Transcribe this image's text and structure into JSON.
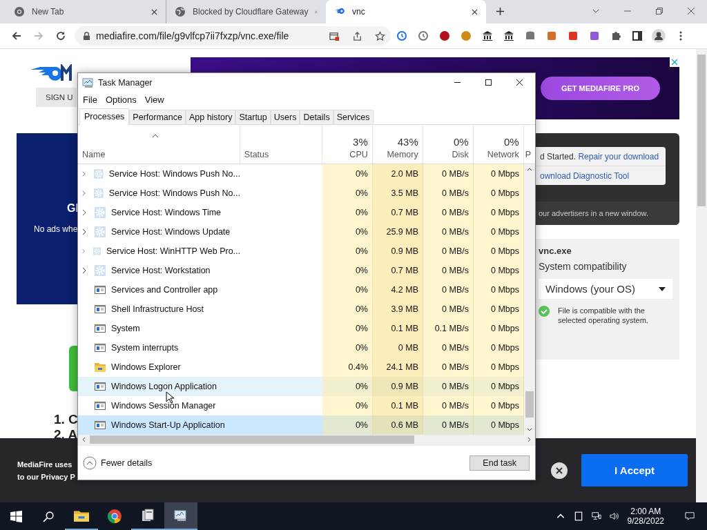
{
  "browser": {
    "tabs": [
      {
        "title": "New Tab",
        "selected": false
      },
      {
        "title": "Blocked by Cloudflare Gateway",
        "selected": false
      },
      {
        "title": "vnc",
        "selected": true
      }
    ],
    "address": "mediafire.com/file/g9vlfcp7ii7fxzp/vnc.exe/file"
  },
  "page": {
    "sign_up": "SIGN U",
    "promo_heading": "Gl",
    "promo_text": "No ads whe",
    "steps": [
      "1. C",
      "2. A"
    ],
    "ad_button": "GET MEDIAFIRE PRO",
    "notice": {
      "text": "d Started.",
      "link": "Repair your download",
      "tool_link": "ownload Diagnostic Tool",
      "footer": "our advertisers in a new window."
    },
    "file": {
      "name": "vnc.exe",
      "label": "System compatibility",
      "select": "Windows (your OS)",
      "status": "File is compatible with the selected operating system."
    },
    "cookie": {
      "lines": [
        "MediaFire uses",
        "to our Privacy P"
      ],
      "accept": "I Accept"
    }
  },
  "task_manager": {
    "title": "Task Manager",
    "menu": [
      "File",
      "Options",
      "View"
    ],
    "tabs": [
      {
        "label": "Processes",
        "selected": true
      },
      {
        "label": "Performance",
        "selected": false
      },
      {
        "label": "App history",
        "selected": false
      },
      {
        "label": "Startup",
        "selected": false
      },
      {
        "label": "Users",
        "selected": false
      },
      {
        "label": "Details",
        "selected": false
      },
      {
        "label": "Services",
        "selected": false
      }
    ],
    "columns": [
      {
        "label": "Name"
      },
      {
        "label": "Status"
      },
      {
        "usage": "3%",
        "label": "CPU"
      },
      {
        "usage": "43%",
        "label": "Memory"
      },
      {
        "usage": "0%",
        "label": "Disk"
      },
      {
        "usage": "0%",
        "label": "Network"
      },
      {
        "label": "P"
      }
    ],
    "rows": [
      {
        "kind": "service",
        "expandable": true,
        "name": "Service Host: Windows Push No...",
        "cpu": "0%",
        "memory": "2.0 MB",
        "disk": "0 MB/s",
        "network": "0 Mbps",
        "hovered": false,
        "selected": false
      },
      {
        "kind": "service",
        "expandable": true,
        "name": "Service Host: Windows Push No...",
        "cpu": "0%",
        "memory": "3.5 MB",
        "disk": "0 MB/s",
        "network": "0 Mbps",
        "hovered": false,
        "selected": false
      },
      {
        "kind": "service",
        "expandable": true,
        "name": "Service Host: Windows Time",
        "cpu": "0%",
        "memory": "0.7 MB",
        "disk": "0 MB/s",
        "network": "0 Mbps",
        "hovered": false,
        "selected": false
      },
      {
        "kind": "service",
        "expandable": true,
        "name": "Service Host: Windows Update",
        "cpu": "0%",
        "memory": "25.9 MB",
        "disk": "0 MB/s",
        "network": "0 Mbps",
        "hovered": false,
        "selected": false
      },
      {
        "kind": "service",
        "expandable": true,
        "name": "Service Host: WinHTTP Web Pro...",
        "cpu": "0%",
        "memory": "0.9 MB",
        "disk": "0 MB/s",
        "network": "0 Mbps",
        "hovered": false,
        "selected": false
      },
      {
        "kind": "service",
        "expandable": true,
        "name": "Service Host: Workstation",
        "cpu": "0%",
        "memory": "0.7 MB",
        "disk": "0 MB/s",
        "network": "0 Mbps",
        "hovered": false,
        "selected": false
      },
      {
        "kind": "app",
        "expandable": false,
        "name": "Services and Controller app",
        "cpu": "0%",
        "memory": "4.2 MB",
        "disk": "0 MB/s",
        "network": "0 Mbps",
        "hovered": false,
        "selected": false
      },
      {
        "kind": "app",
        "expandable": false,
        "name": "Shell Infrastructure Host",
        "cpu": "0%",
        "memory": "3.9 MB",
        "disk": "0 MB/s",
        "network": "0 Mbps",
        "hovered": false,
        "selected": false
      },
      {
        "kind": "app",
        "expandable": false,
        "name": "System",
        "cpu": "0%",
        "memory": "0.1 MB",
        "disk": "0.1 MB/s",
        "network": "0 Mbps",
        "hovered": false,
        "selected": false
      },
      {
        "kind": "app",
        "expandable": false,
        "name": "System interrupts",
        "cpu": "0%",
        "memory": "0 MB",
        "disk": "0 MB/s",
        "network": "0 Mbps",
        "hovered": false,
        "selected": false
      },
      {
        "kind": "folder",
        "expandable": false,
        "name": "Windows Explorer",
        "cpu": "0.4%",
        "memory": "24.1 MB",
        "disk": "0 MB/s",
        "network": "0 Mbps",
        "hovered": false,
        "selected": false
      },
      {
        "kind": "app",
        "expandable": false,
        "name": "Windows Logon Application",
        "cpu": "0%",
        "memory": "0.9 MB",
        "disk": "0 MB/s",
        "network": "0 Mbps",
        "hovered": true,
        "selected": false
      },
      {
        "kind": "app",
        "expandable": false,
        "name": "Windows Session Manager",
        "cpu": "0%",
        "memory": "0.1 MB",
        "disk": "0 MB/s",
        "network": "0 Mbps",
        "hovered": false,
        "selected": false
      },
      {
        "kind": "app",
        "expandable": false,
        "name": "Windows Start-Up Application",
        "cpu": "0%",
        "memory": "0.6 MB",
        "disk": "0 MB/s",
        "network": "0 Mbps",
        "hovered": false,
        "selected": true
      }
    ],
    "fewer_details": "Fewer details",
    "end_task": "End task"
  },
  "taskbar": {
    "time": "2:00 AM",
    "date": "9/28/2022"
  }
}
